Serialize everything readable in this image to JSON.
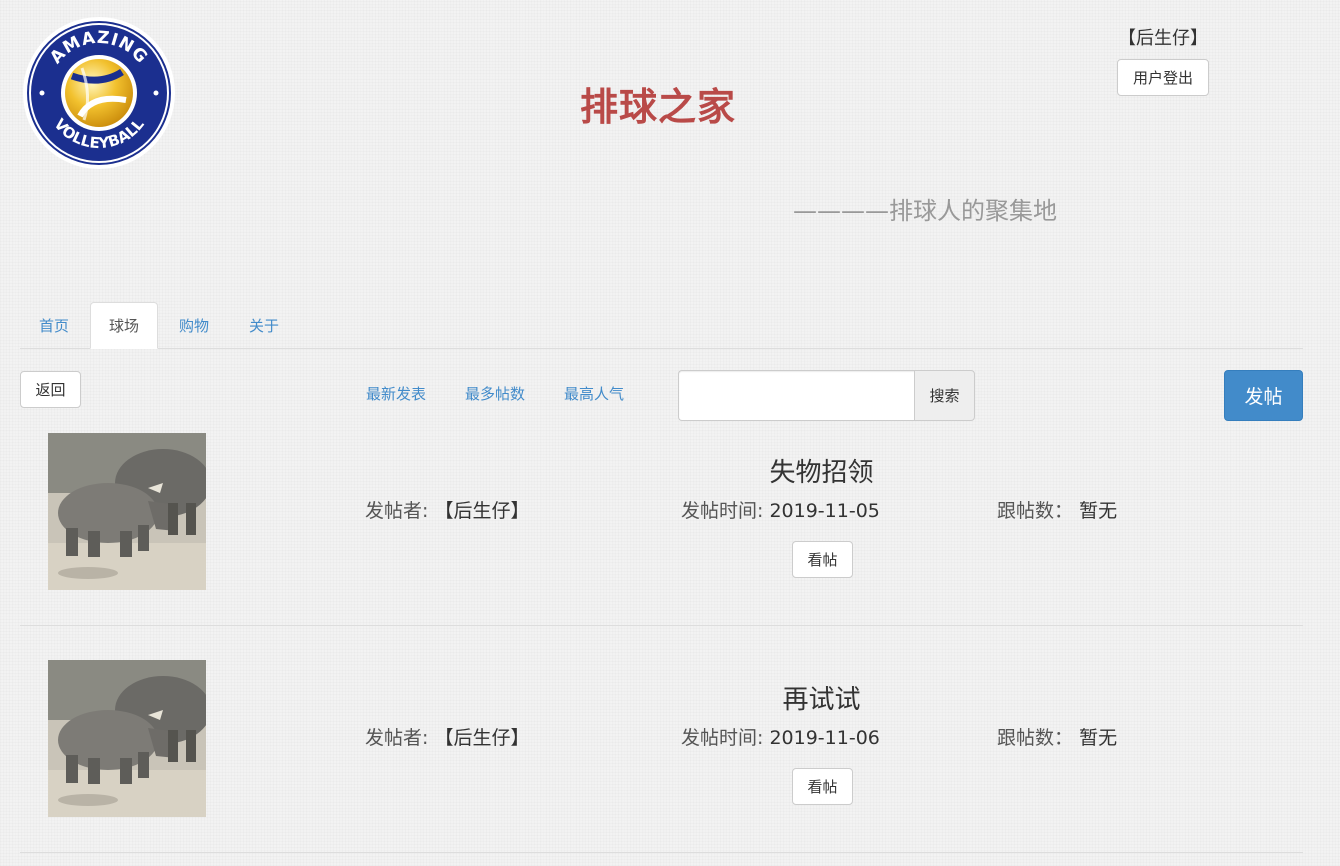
{
  "header": {
    "site_title": "排球之家",
    "subtitle": "————排球人的聚集地",
    "user_name": "【后生仔】",
    "logout_label": "用户登出",
    "logo": {
      "top_text": "AMAZING",
      "bottom_text": "VOLLEYBALL"
    }
  },
  "nav": {
    "tabs": [
      {
        "label": "首页",
        "active": false
      },
      {
        "label": "球场",
        "active": true
      },
      {
        "label": "购物",
        "active": false
      },
      {
        "label": "关于",
        "active": false
      }
    ]
  },
  "toolbar": {
    "back_label": "返回",
    "sort_links": [
      "最新发表",
      "最多帖数",
      "最高人气"
    ],
    "search": {
      "value": "",
      "placeholder": ""
    },
    "search_label": "搜索",
    "post_label": "发帖"
  },
  "posts": [
    {
      "title": "失物招领",
      "author_label": "发帖者:",
      "author": "【后生仔】",
      "time_label": "发帖时间:",
      "time": "2019-11-05",
      "replies_label": "跟帖数：",
      "replies": "暂无",
      "view_label": "看帖"
    },
    {
      "title": "再试试",
      "author_label": "发帖者:",
      "author": "【后生仔】",
      "time_label": "发帖时间:",
      "time": "2019-11-06",
      "replies_label": "跟帖数：",
      "replies": "暂无",
      "view_label": "看帖"
    }
  ],
  "colors": {
    "title_red": "#b94a48",
    "link_blue": "#428bca",
    "primary_button": "#428bca"
  }
}
